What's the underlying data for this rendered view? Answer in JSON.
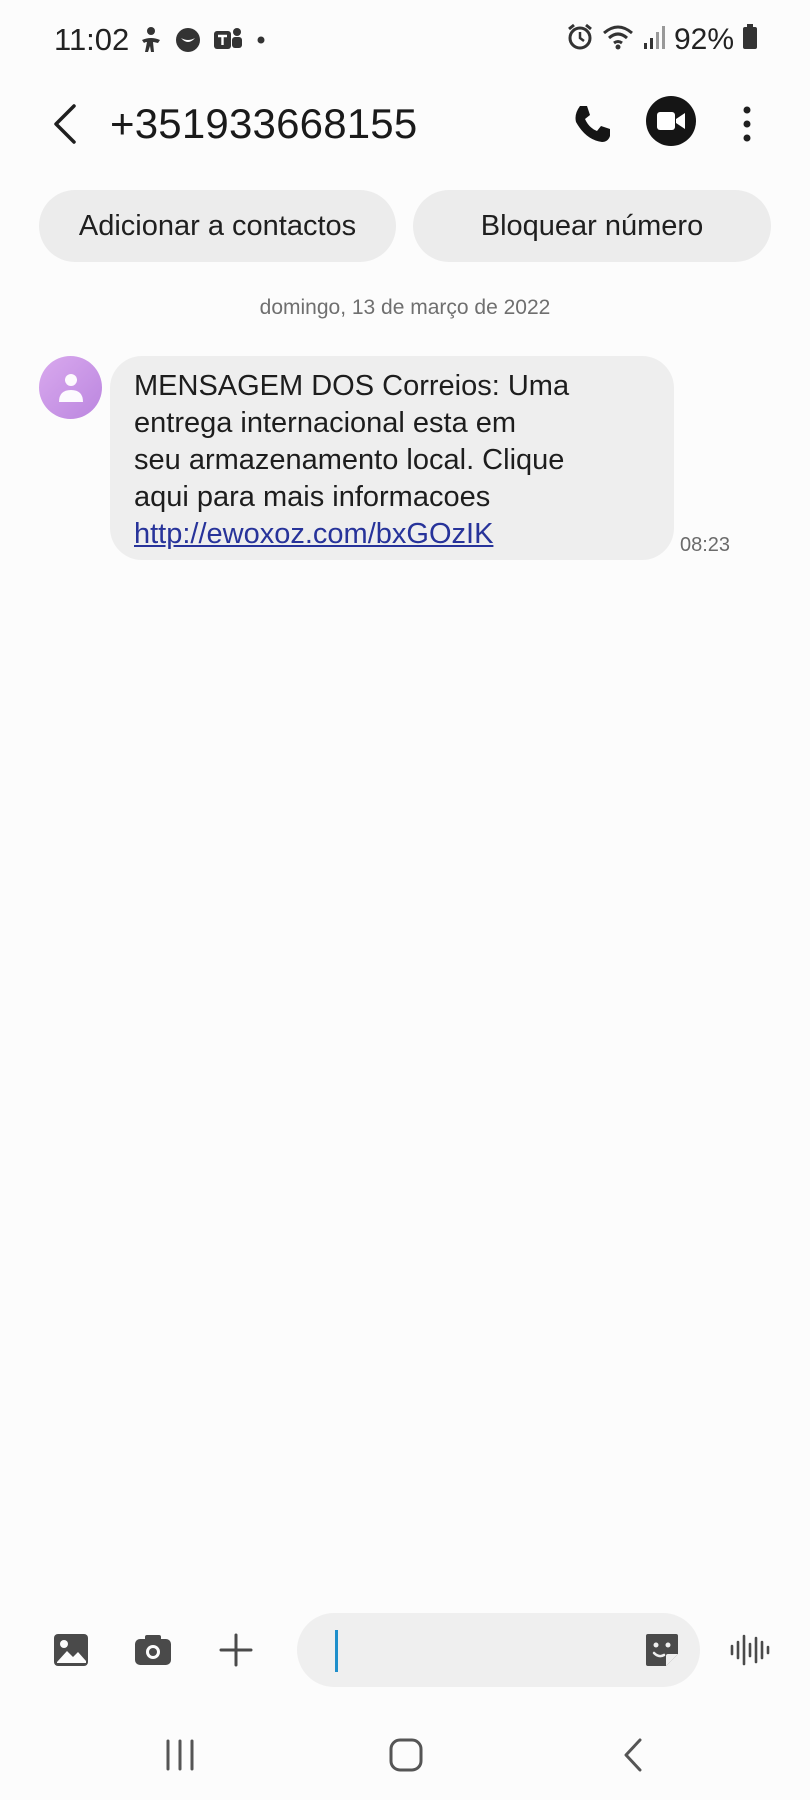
{
  "status_bar": {
    "time": "11:02",
    "battery_percent": "92%",
    "icons": [
      "accessibility-icon",
      "messenger-icon",
      "teams-icon",
      "dot-icon",
      "alarm-icon",
      "wifi-icon",
      "signal-icon",
      "battery-icon"
    ]
  },
  "header": {
    "contact": "+351933668155",
    "icons": [
      "back-arrow-icon",
      "phone-icon",
      "video-call-icon",
      "more-vert-icon"
    ]
  },
  "actions": {
    "add_contact": "Adicionar a contactos",
    "block_number": "Bloquear número"
  },
  "conversation": {
    "date": "domingo, 13 de março de 2022",
    "messages": [
      {
        "lines": [
          "MENSAGEM DOS Correios: Uma",
          "entrega internacional esta em",
          "seu armazenamento local. Clique",
          "aqui para mais informacoes"
        ],
        "link": "http://ewoxoz.com/bxGOzIK",
        "time": "08:23"
      }
    ]
  },
  "composer": {
    "placeholder": "",
    "icons": [
      "gallery-icon",
      "camera-icon",
      "add-icon",
      "sticker-icon",
      "voice-wave-icon"
    ]
  },
  "colors": {
    "background": "#fcfcfc",
    "bubble": "#eeeeee",
    "chip": "#ececec",
    "link": "#27339a",
    "avatar": "#c896e6",
    "cursor": "#1f8fcb"
  }
}
